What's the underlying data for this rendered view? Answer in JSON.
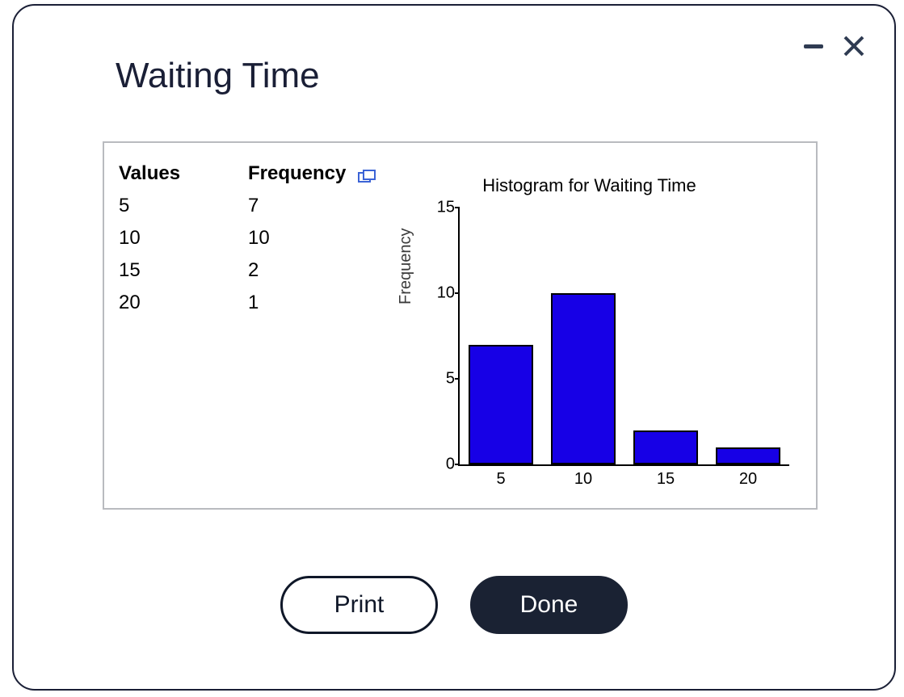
{
  "window": {
    "title": "Waiting Time"
  },
  "table": {
    "headers": {
      "values": "Values",
      "frequency": "Frequency"
    },
    "rows": [
      {
        "value": "5",
        "freq": "7"
      },
      {
        "value": "10",
        "freq": "10"
      },
      {
        "value": "15",
        "freq": "2"
      },
      {
        "value": "20",
        "freq": "1"
      }
    ]
  },
  "chart_data": {
    "type": "bar",
    "title": "Histogram for Waiting Time",
    "xlabel": "",
    "ylabel": "Frequency",
    "categories": [
      "5",
      "10",
      "15",
      "20"
    ],
    "values": [
      7,
      10,
      2,
      1
    ],
    "ylim": [
      0,
      15
    ],
    "yticks": [
      0,
      5,
      10,
      15
    ],
    "bar_color": "#1700e6"
  },
  "buttons": {
    "print": "Print",
    "done": "Done"
  }
}
